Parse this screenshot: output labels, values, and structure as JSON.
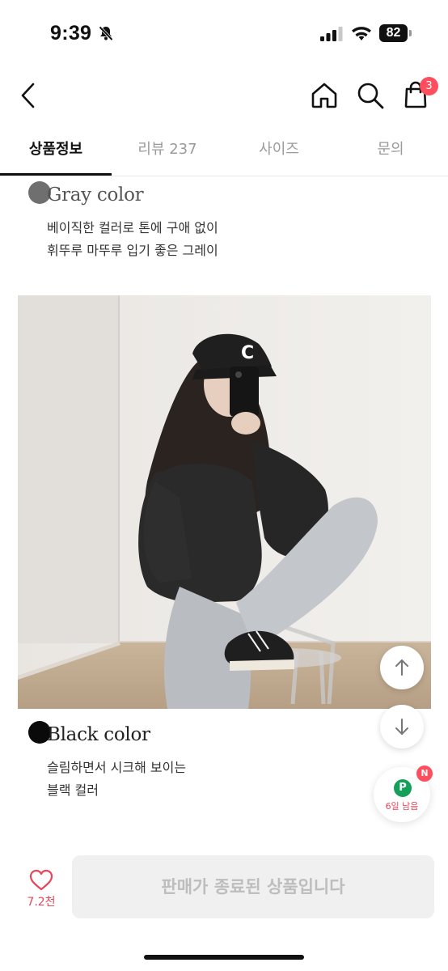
{
  "status_bar": {
    "time": "9:39",
    "battery": "82"
  },
  "header": {
    "cart_count": "3"
  },
  "tabs": [
    {
      "label": "상품정보",
      "active": true
    },
    {
      "label": "리뷰 237",
      "active": false
    },
    {
      "label": "사이즈",
      "active": false
    },
    {
      "label": "문의",
      "active": false
    }
  ],
  "sections": {
    "gray": {
      "title": "Gray color",
      "desc_line1": "베이직한 컬러로 톤에 구애 없이",
      "desc_line2": "휘뚜루 마뚜루 입기 좋은 그레이",
      "dot_color": "#6f6f6f"
    },
    "black": {
      "title": "Black color",
      "desc_line1": "슬림하면서 시크해 보이는",
      "desc_line2": "블랙 컬러",
      "dot_color": "#0a0a0a"
    }
  },
  "photo": {
    "cap_letter": "C"
  },
  "promo": {
    "badge": "N",
    "icon_letter": "P",
    "label": "6일 남음"
  },
  "bottom_bar": {
    "like_count": "7.2천",
    "action_label": "판매가 종료된 상품입니다"
  },
  "colors": {
    "accent": "#ff4f5e",
    "promo_green": "#12a05a",
    "disabled_bg": "#f0f0f0",
    "disabled_text": "#bdbdbd"
  }
}
